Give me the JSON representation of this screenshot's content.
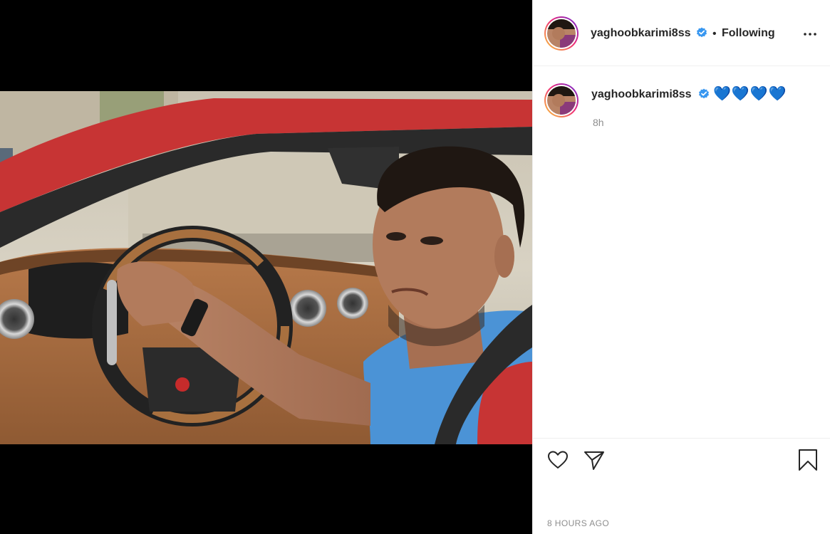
{
  "post": {
    "media": {
      "image_icon": "photo-man-in-red-convertible-car"
    },
    "header": {
      "username": "yaghoobkarimi8ss",
      "verified_icon": "verified-badge-icon",
      "separator": "•",
      "follow_label": "Following",
      "more_icon": "more-options-icon"
    },
    "caption": {
      "username": "yaghoobkarimi8ss",
      "verified_icon": "verified-badge-icon",
      "text": "💙💙💙💙",
      "time_ago": "8h"
    },
    "actions": {
      "like_icon": "heart-icon",
      "share_icon": "paper-plane-icon",
      "save_icon": "bookmark-icon",
      "timestamp": "8 HOURS AGO"
    },
    "colors": {
      "verified_blue": "#3897f0",
      "heart_emoji_blue": "#33c3f0",
      "muted_text": "#8e8e8e",
      "primary_text": "#262626"
    }
  }
}
